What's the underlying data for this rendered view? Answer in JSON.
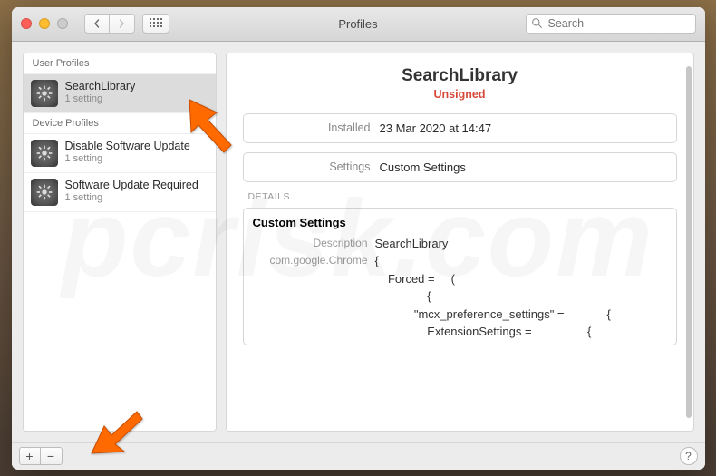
{
  "window": {
    "title": "Profiles",
    "search_placeholder": "Search"
  },
  "sidebar": {
    "section_user": "User Profiles",
    "section_device": "Device Profiles",
    "items": [
      {
        "name": "SearchLibrary",
        "sub": "1 setting",
        "selected": true
      },
      {
        "name": "Disable Software Update",
        "sub": "1 setting",
        "selected": false
      },
      {
        "name": "Software Update Required",
        "sub": "1 setting",
        "selected": false
      }
    ]
  },
  "detail": {
    "title": "SearchLibrary",
    "status": "Unsigned",
    "installed_label": "Installed",
    "installed_value": "23 Mar 2020 at 14:47",
    "settings_label": "Settings",
    "settings_value": "Custom Settings",
    "details_header": "DETAILS",
    "details_title": "Custom Settings",
    "description_label": "Description",
    "description_value": "SearchLibrary",
    "domain_label": "com.google.Chrome",
    "domain_value": "{\n    Forced =     (\n                {\n            \"mcx_preference_settings\" =             {\n                ExtensionSettings =                 {"
  },
  "footer": {
    "add": "+",
    "remove": "−",
    "help": "?"
  },
  "watermark": "pcrisk.com"
}
